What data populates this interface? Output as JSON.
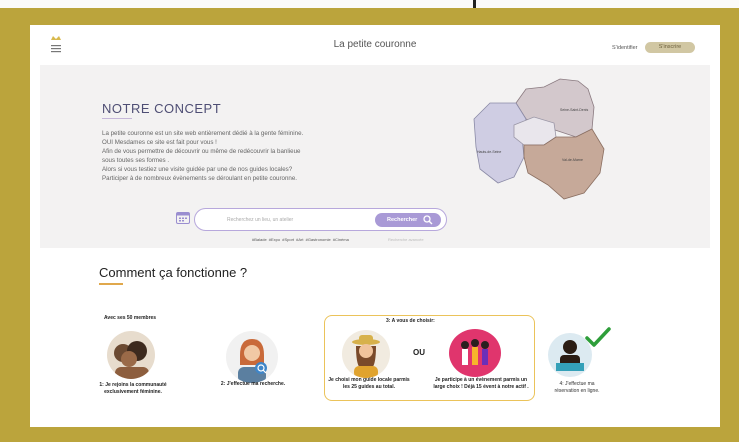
{
  "header": {
    "site_title": "La petite couronne",
    "login_label": "S'identifier",
    "signup_label": "S'inscrire",
    "logo_icon": "crown-menu-icon"
  },
  "hero": {
    "title": "NOTRE CONCEPT",
    "lines": [
      "La petite couronne est un site web entièrement dédié à la gente féminine.",
      "OUI Mesdames ce site est fait pour vous !",
      "Afin de vous permettre de découvrir ou même de redécouvrir la banlieue",
      "sous toutes ses formes .",
      "Alors si vous testiez une visite guidée par une de nos guides locales?",
      "Participer à de nombreux évènements  se déroulant en petite couronne."
    ],
    "map_labels": {
      "north": "Seine-Saint-Denis",
      "west": "Hauts-de-Seine",
      "south": "Val-de-Marne"
    }
  },
  "search": {
    "placeholder": "Recherchez un lieu, un atelier",
    "button_label": "Rechercher",
    "tags": "#Balade  #Expo  #Sport  #Art  #Gastronomie  #Cinéma",
    "advanced_link": "Recherche avancée"
  },
  "how": {
    "title": "Comment ça fonctionne ?",
    "step1_header": "Avec  ses 50 membres",
    "step1_caption_1": "1: Je rejoins la communauté",
    "step1_caption_2": "exclusivement féminine.",
    "step2_caption": "2: J'effectue ma recherche.",
    "step3_header": "3:  A vous de choisir:",
    "step3_left_1": "Je choisi mon guide locale parmis",
    "step3_left_2": "les 25 guides au total.",
    "or_label": "OU",
    "step3_right_1": "Je participe à un évènement parmis un",
    "step3_right_2": "large choix ! Déjà 15 évent à notre actif .",
    "step4_caption_1": "4: J'effectue ma",
    "step4_caption_2": "réservation en ligne."
  },
  "colors": {
    "frame": "#bba43c",
    "accent_purple": "#a99ad6",
    "accent_gold": "#ebc35a"
  }
}
